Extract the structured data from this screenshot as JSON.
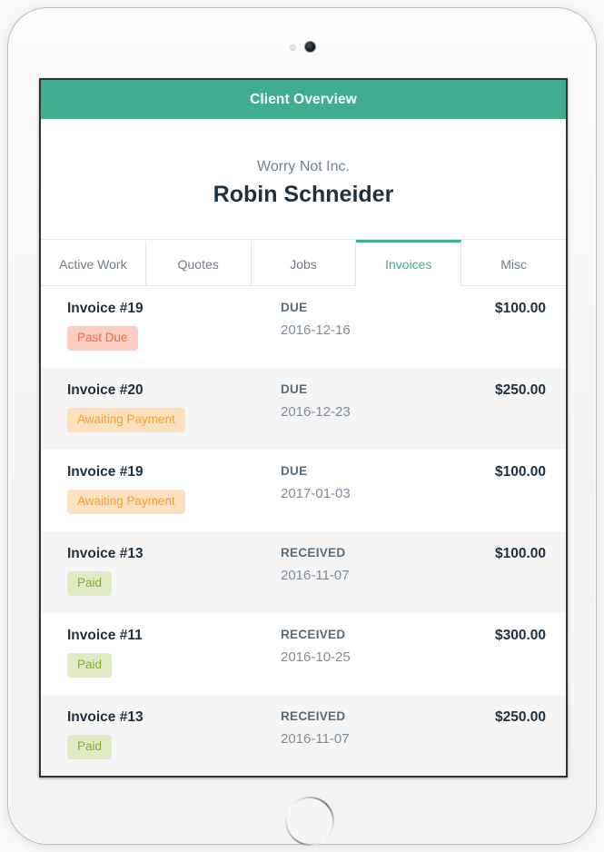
{
  "device": {
    "camera_icon": "front-camera-lens",
    "sensor_icon": "ambient-light-sensor",
    "home_button_icon": "home-button"
  },
  "header": {
    "title": "Client Overview",
    "accent_color": "#3fae90"
  },
  "client": {
    "company": "Worry Not Inc.",
    "name": "Robin Schneider"
  },
  "tabs": [
    {
      "label": "Active Work",
      "active": false
    },
    {
      "label": "Quotes",
      "active": false
    },
    {
      "label": "Jobs",
      "active": false
    },
    {
      "label": "Invoices",
      "active": true
    },
    {
      "label": "Misc",
      "active": false
    }
  ],
  "invoices": [
    {
      "title": "Invoice #19",
      "badge": "Past Due",
      "badge_type": "past-due",
      "badge_bg": "#fbcdc1",
      "badge_fg": "#f26a4c",
      "status": "DUE",
      "date": "2016-12-16",
      "amount": "$100.00"
    },
    {
      "title": "Invoice #20",
      "badge": "Awaiting Payment",
      "badge_type": "awaiting",
      "badge_bg": "#fde0bd",
      "badge_fg": "#efa133",
      "status": "DUE",
      "date": "2016-12-23",
      "amount": "$250.00"
    },
    {
      "title": "Invoice #19",
      "badge": "Awaiting Payment",
      "badge_type": "awaiting",
      "badge_bg": "#fde0bd",
      "badge_fg": "#efa133",
      "status": "DUE",
      "date": "2017-01-03",
      "amount": "$100.00"
    },
    {
      "title": "Invoice #13",
      "badge": "Paid",
      "badge_type": "paid",
      "badge_bg": "#e0ebc6",
      "badge_fg": "#7fae2c",
      "status": "RECEIVED",
      "date": "2016-11-07",
      "amount": "$100.00"
    },
    {
      "title": "Invoice #11",
      "badge": "Paid",
      "badge_type": "paid",
      "badge_bg": "#e0ebc6",
      "badge_fg": "#7fae2c",
      "status": "RECEIVED",
      "date": "2016-10-25",
      "amount": "$300.00"
    },
    {
      "title": "Invoice #13",
      "badge": "Paid",
      "badge_type": "paid",
      "badge_bg": "#e0ebc6",
      "badge_fg": "#7fae2c",
      "status": "RECEIVED",
      "date": "2016-11-07",
      "amount": "$250.00"
    }
  ]
}
